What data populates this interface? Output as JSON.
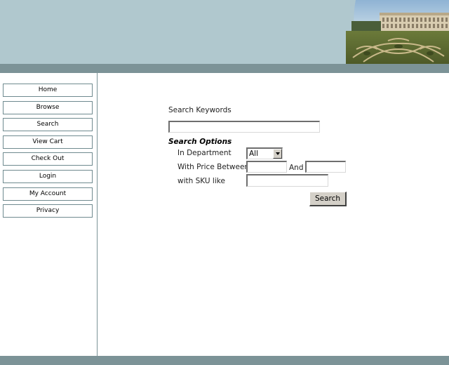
{
  "nav": {
    "items": [
      "Home",
      "Browse",
      "Search",
      "View Cart",
      "Check Out",
      "Login",
      "My Account",
      "Privacy"
    ]
  },
  "search": {
    "keywords_label": "Search Keywords",
    "keywords_value": "",
    "options_heading": "Search Options",
    "department_label": "In Department",
    "department_selected": "All",
    "price_label": "With Price Between",
    "price_and": "And",
    "price_min": "",
    "price_max": "",
    "sku_label": "with SKU like",
    "sku_value": "",
    "submit_label": "Search"
  },
  "icons": {
    "department_dropdown": "chevron-down-icon"
  },
  "colors": {
    "header": "#b0c8ce",
    "band": "#7c9397",
    "nav_border": "#6f8a8f"
  }
}
